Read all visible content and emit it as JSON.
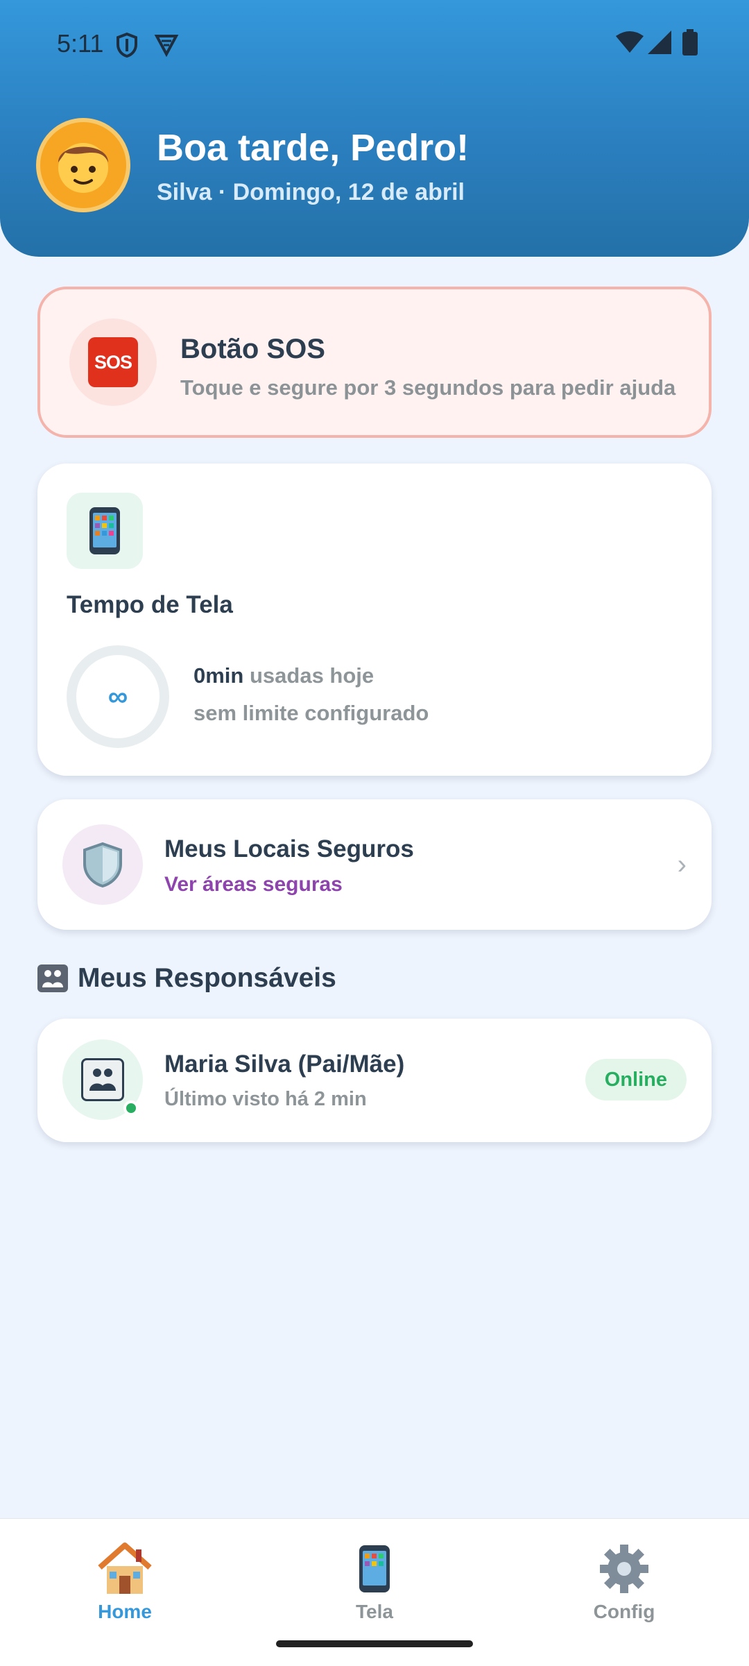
{
  "status_bar": {
    "time": "5:11"
  },
  "header": {
    "avatar_icon": "boy-face-icon",
    "greeting": "Boa tarde, Pedro!",
    "subline": "Silva · Domingo, 12 de abril"
  },
  "sos": {
    "badge": "SOS",
    "title": "Botão SOS",
    "subtitle": "Toque e segure por 3 segundos para pedir ajuda"
  },
  "screen_time": {
    "title": "Tempo de Tela",
    "ring_symbol": "∞",
    "used_value": "0min",
    "used_suffix": " usadas hoje",
    "limit_text": "sem limite configurado"
  },
  "safe_places": {
    "title": "Meus Locais Seguros",
    "link": "Ver áreas seguras",
    "chevron": "›"
  },
  "guardians": {
    "section_title": "Meus Responsáveis",
    "items": [
      {
        "name": "Maria Silva (Pai/Mãe)",
        "last_seen": "Último visto há 2 min",
        "status": "Online"
      }
    ]
  },
  "nav": {
    "items": [
      {
        "label": "Home",
        "icon": "house-icon",
        "active": true
      },
      {
        "label": "Tela",
        "icon": "phone-icon",
        "active": false
      },
      {
        "label": "Config",
        "icon": "gear-icon",
        "active": false
      }
    ]
  },
  "colors": {
    "primary": "#3498db",
    "danger": "#e0311d",
    "success": "#27ae60",
    "purple": "#8e44ad"
  }
}
